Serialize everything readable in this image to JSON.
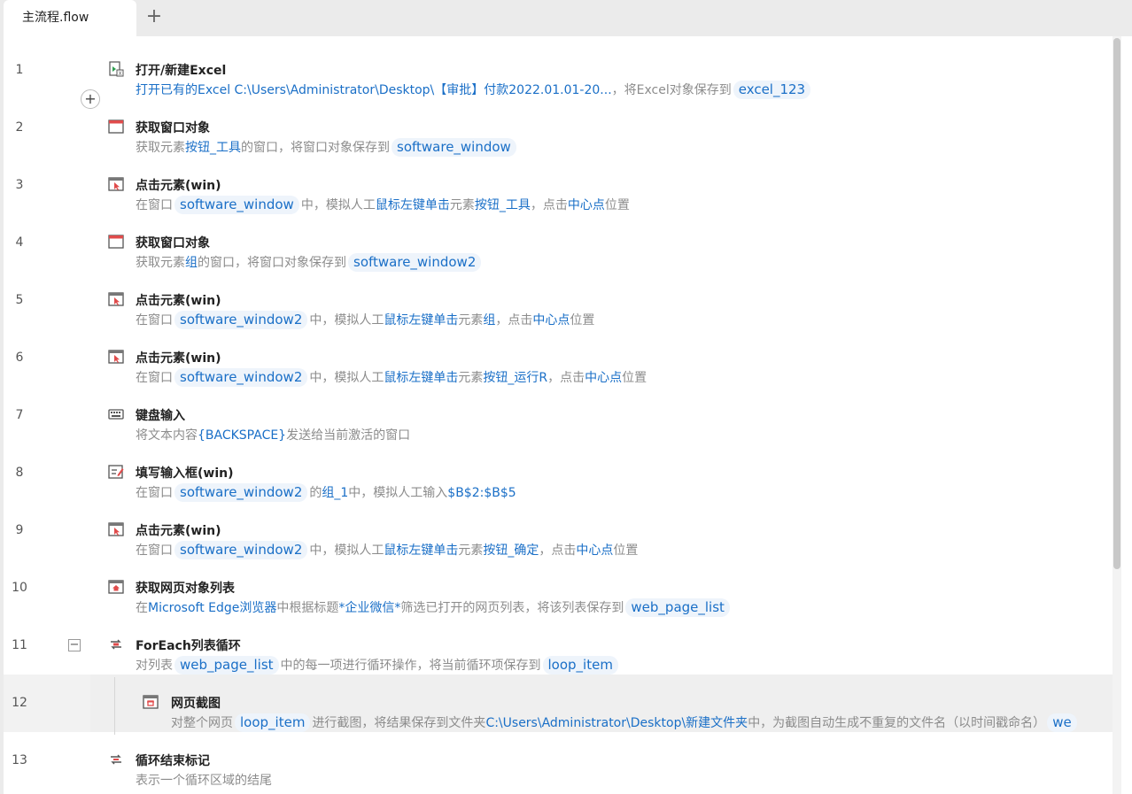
{
  "tabbar": {
    "active_tab": "主流程.flow",
    "add_tab_label": "+"
  },
  "colors": {
    "accent": "#1a6fc7",
    "variable_bg": "#eef4fb",
    "muted_text": "#8c8c8c",
    "selected_row_bg": "#efefef"
  },
  "steps": [
    {
      "line": "1",
      "icon": "excel-icon",
      "title": "打开/新建Excel",
      "desc": [
        {
          "t": "link",
          "v": "打开已有的Excel C:\\Users\\Administrator\\Desktop\\【审批】付款2022.01.01-20..."
        },
        {
          "t": "text",
          "v": "，将Excel对象保存到"
        },
        {
          "t": "var",
          "v": "excel_123"
        }
      ]
    },
    {
      "line": "2",
      "icon": "window-icon",
      "title": "获取窗口对象",
      "desc": [
        {
          "t": "text",
          "v": "获取元素"
        },
        {
          "t": "link",
          "v": "按钮_工具"
        },
        {
          "t": "text",
          "v": "的窗口，将窗口对象保存到"
        },
        {
          "t": "var",
          "v": "software_window"
        }
      ]
    },
    {
      "line": "3",
      "icon": "click-element-icon",
      "title": "点击元素(win)",
      "desc": [
        {
          "t": "text",
          "v": "在窗口"
        },
        {
          "t": "var",
          "v": "software_window"
        },
        {
          "t": "text",
          "v": "中，模拟人工"
        },
        {
          "t": "link",
          "v": "鼠标左键单击"
        },
        {
          "t": "text",
          "v": "元素"
        },
        {
          "t": "link",
          "v": "按钮_工具"
        },
        {
          "t": "text",
          "v": "，点击"
        },
        {
          "t": "link",
          "v": "中心点"
        },
        {
          "t": "text",
          "v": "位置"
        }
      ]
    },
    {
      "line": "4",
      "icon": "window-icon",
      "title": "获取窗口对象",
      "desc": [
        {
          "t": "text",
          "v": "获取元素"
        },
        {
          "t": "link",
          "v": "组"
        },
        {
          "t": "text",
          "v": "的窗口，将窗口对象保存到"
        },
        {
          "t": "var",
          "v": "software_window2"
        }
      ]
    },
    {
      "line": "5",
      "icon": "click-element-icon",
      "title": "点击元素(win)",
      "desc": [
        {
          "t": "text",
          "v": "在窗口"
        },
        {
          "t": "var",
          "v": "software_window2"
        },
        {
          "t": "text",
          "v": "中，模拟人工"
        },
        {
          "t": "link",
          "v": "鼠标左键单击"
        },
        {
          "t": "text",
          "v": "元素"
        },
        {
          "t": "link",
          "v": "组"
        },
        {
          "t": "text",
          "v": "，点击"
        },
        {
          "t": "link",
          "v": "中心点"
        },
        {
          "t": "text",
          "v": "位置"
        }
      ]
    },
    {
      "line": "6",
      "icon": "click-element-icon",
      "title": "点击元素(win)",
      "desc": [
        {
          "t": "text",
          "v": "在窗口"
        },
        {
          "t": "var",
          "v": "software_window2"
        },
        {
          "t": "text",
          "v": "中，模拟人工"
        },
        {
          "t": "link",
          "v": "鼠标左键单击"
        },
        {
          "t": "text",
          "v": "元素"
        },
        {
          "t": "link",
          "v": "按钮_运行R"
        },
        {
          "t": "text",
          "v": "，点击"
        },
        {
          "t": "link",
          "v": "中心点"
        },
        {
          "t": "text",
          "v": "位置"
        }
      ]
    },
    {
      "line": "7",
      "icon": "keyboard-icon",
      "title": "键盘输入",
      "desc": [
        {
          "t": "text",
          "v": "将文本内容"
        },
        {
          "t": "link",
          "v": "{BACKSPACE}"
        },
        {
          "t": "text",
          "v": "发送给当前激活的窗口"
        }
      ]
    },
    {
      "line": "8",
      "icon": "input-fill-icon",
      "title": "填写输入框(win)",
      "desc": [
        {
          "t": "text",
          "v": "在窗口"
        },
        {
          "t": "var",
          "v": "software_window2"
        },
        {
          "t": "text",
          "v": "的"
        },
        {
          "t": "link",
          "v": "组_1"
        },
        {
          "t": "text",
          "v": "中，模拟人工输入"
        },
        {
          "t": "link",
          "v": "$B$2:$B$5"
        }
      ]
    },
    {
      "line": "9",
      "icon": "click-element-icon",
      "title": "点击元素(win)",
      "desc": [
        {
          "t": "text",
          "v": "在窗口"
        },
        {
          "t": "var",
          "v": "software_window2"
        },
        {
          "t": "text",
          "v": "中，模拟人工"
        },
        {
          "t": "link",
          "v": "鼠标左键单击"
        },
        {
          "t": "text",
          "v": "元素"
        },
        {
          "t": "link",
          "v": "按钮_确定"
        },
        {
          "t": "text",
          "v": "，点击"
        },
        {
          "t": "link",
          "v": "中心点"
        },
        {
          "t": "text",
          "v": "位置"
        }
      ]
    },
    {
      "line": "10",
      "icon": "webpage-list-icon",
      "title": "获取网页对象列表",
      "desc": [
        {
          "t": "text",
          "v": "在"
        },
        {
          "t": "link",
          "v": "Microsoft Edge浏览器"
        },
        {
          "t": "text",
          "v": "中根据标题"
        },
        {
          "t": "link",
          "v": "*企业微信*"
        },
        {
          "t": "text",
          "v": "筛选已打开的网页列表，将该列表保存到"
        },
        {
          "t": "var",
          "v": "web_page_list"
        }
      ]
    },
    {
      "line": "11",
      "icon": "foreach-loop-icon",
      "title": "ForEach列表循环",
      "collapsible": true,
      "collapse_label": "−",
      "desc": [
        {
          "t": "text",
          "v": "对列表"
        },
        {
          "t": "var",
          "v": "web_page_list"
        },
        {
          "t": "text",
          "v": "中的每一项进行循环操作，将当前循环项保存到"
        },
        {
          "t": "var",
          "v": "loop_item"
        }
      ]
    },
    {
      "line": "12",
      "icon": "screenshot-icon",
      "title": "网页截图",
      "nested": true,
      "selected": true,
      "desc": [
        {
          "t": "text",
          "v": "对整个网页"
        },
        {
          "t": "var",
          "v": "loop_item"
        },
        {
          "t": "text",
          "v": "进行截图，将结果保存到文件夹"
        },
        {
          "t": "link",
          "v": "C:\\Users\\Administrator\\Desktop\\新建文件夹"
        },
        {
          "t": "text",
          "v": "中，为截图自动生成不重复的文件名（以时间戳命名）"
        },
        {
          "t": "var",
          "v": "we"
        }
      ]
    },
    {
      "line": "13",
      "icon": "loop-end-icon",
      "title": "循环结束标记",
      "desc": [
        {
          "t": "text",
          "v": "表示一个循环区域的结尾"
        }
      ]
    }
  ],
  "add_step_label": "+"
}
